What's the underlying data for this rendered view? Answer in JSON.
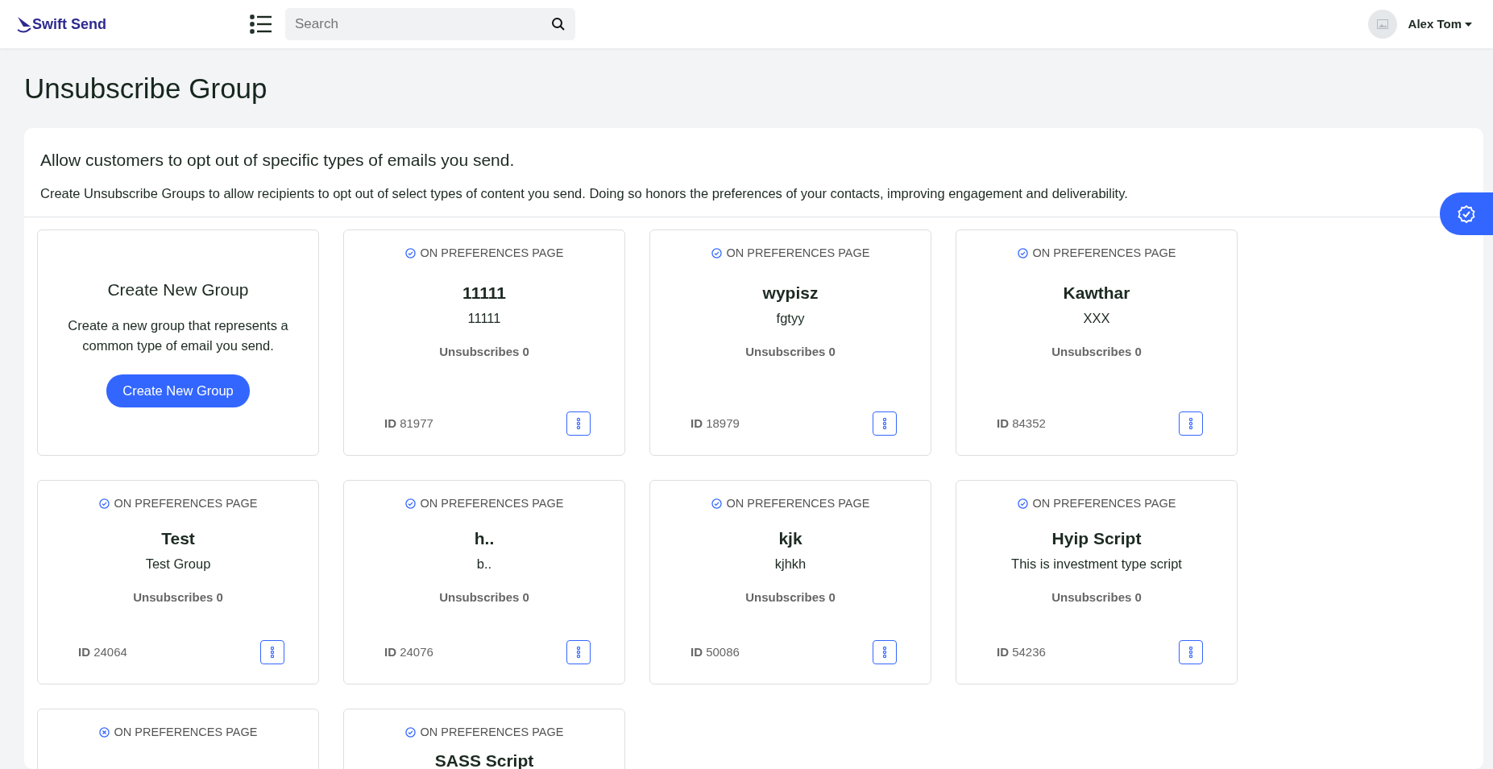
{
  "navbar": {
    "brand": "Swift Send",
    "search": {
      "placeholder": "Search"
    },
    "user": {
      "name": "Alex Tom"
    }
  },
  "page": {
    "title": "Unsubscribe Group"
  },
  "intro": {
    "heading": "Allow customers to opt out of specific types of emails you send.",
    "description": "Create Unsubscribe Groups to allow recipients to opt out of select types of content you send. Doing so honors the preferences of your contacts, improving engagement and deliverability."
  },
  "create_card": {
    "title": "Create New Group",
    "description": "Create a new group that represents a common type of email you send.",
    "button": "Create New Group"
  },
  "groups": [
    {
      "badge": "ON PREFERENCES PAGE",
      "on_preferences_page": true,
      "name": "11111",
      "description": "11111",
      "unsubscribes_label": "Unsubscribes",
      "unsubscribes": "0",
      "id_label": "ID",
      "id": "81977"
    },
    {
      "badge": "ON PREFERENCES PAGE",
      "on_preferences_page": true,
      "name": "wypisz",
      "description": "fgtyy",
      "unsubscribes_label": "Unsubscribes",
      "unsubscribes": "0",
      "id_label": "ID",
      "id": "18979"
    },
    {
      "badge": "ON PREFERENCES PAGE",
      "on_preferences_page": true,
      "name": "Kawthar",
      "description": "XXX",
      "unsubscribes_label": "Unsubscribes",
      "unsubscribes": "0",
      "id_label": "ID",
      "id": "84352"
    },
    {
      "badge": "ON PREFERENCES PAGE",
      "on_preferences_page": true,
      "name": "Test",
      "description": "Test Group",
      "unsubscribes_label": "Unsubscribes",
      "unsubscribes": "0",
      "id_label": "ID",
      "id": "24064"
    },
    {
      "badge": "ON PREFERENCES PAGE",
      "on_preferences_page": true,
      "name": "h..",
      "description": "b..",
      "unsubscribes_label": "Unsubscribes",
      "unsubscribes": "0",
      "id_label": "ID",
      "id": "24076"
    },
    {
      "badge": "ON PREFERENCES PAGE",
      "on_preferences_page": true,
      "name": "kjk",
      "description": "kjhkh",
      "unsubscribes_label": "Unsubscribes",
      "unsubscribes": "0",
      "id_label": "ID",
      "id": "50086"
    },
    {
      "badge": "ON PREFERENCES PAGE",
      "on_preferences_page": true,
      "name": "Hyip Script",
      "description": "This is investment type script",
      "unsubscribes_label": "Unsubscribes",
      "unsubscribes": "0",
      "id_label": "ID",
      "id": "54236"
    },
    {
      "badge": "ON PREFERENCES PAGE",
      "on_preferences_page": false
    },
    {
      "badge": "ON PREFERENCES PAGE",
      "on_preferences_page": true,
      "name": "SASS Script"
    }
  ]
}
